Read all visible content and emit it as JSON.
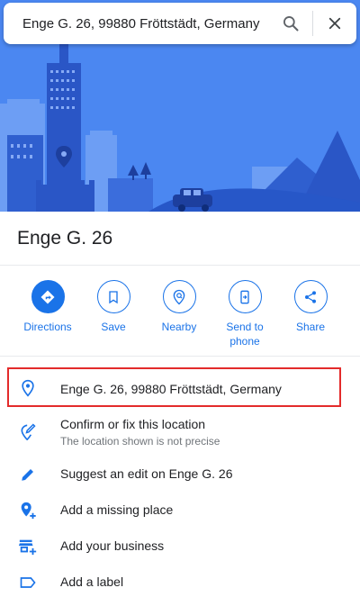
{
  "search": {
    "value": "Enge G. 26, 99880 Fröttstädt, Germany",
    "search_icon": "search-icon",
    "close_icon": "close-icon"
  },
  "place": {
    "title": "Enge G. 26"
  },
  "actions": [
    {
      "label": "Directions",
      "icon": "directions-icon"
    },
    {
      "label": "Save",
      "icon": "bookmark-icon"
    },
    {
      "label": "Nearby",
      "icon": "nearby-icon"
    },
    {
      "label": "Send to phone",
      "icon": "send-to-phone-icon"
    },
    {
      "label": "Share",
      "icon": "share-icon"
    }
  ],
  "details": {
    "address": {
      "text": "Enge G. 26, 99880 Fröttstädt, Germany",
      "icon": "location-pin-icon"
    },
    "confirm": {
      "text": "Confirm or fix this location",
      "sub": "The location shown is not precise",
      "icon": "edit-location-icon"
    },
    "suggest": {
      "text": "Suggest an edit on Enge G. 26",
      "icon": "pencil-icon"
    },
    "missing_place": {
      "text": "Add a missing place",
      "icon": "add-location-icon"
    },
    "business": {
      "text": "Add your business",
      "icon": "add-business-icon"
    },
    "label": {
      "text": "Add a label",
      "icon": "label-icon"
    }
  },
  "colors": {
    "accent": "#1a73e8",
    "hero_bg": "#4a86f0",
    "highlight": "#e32b2b"
  }
}
